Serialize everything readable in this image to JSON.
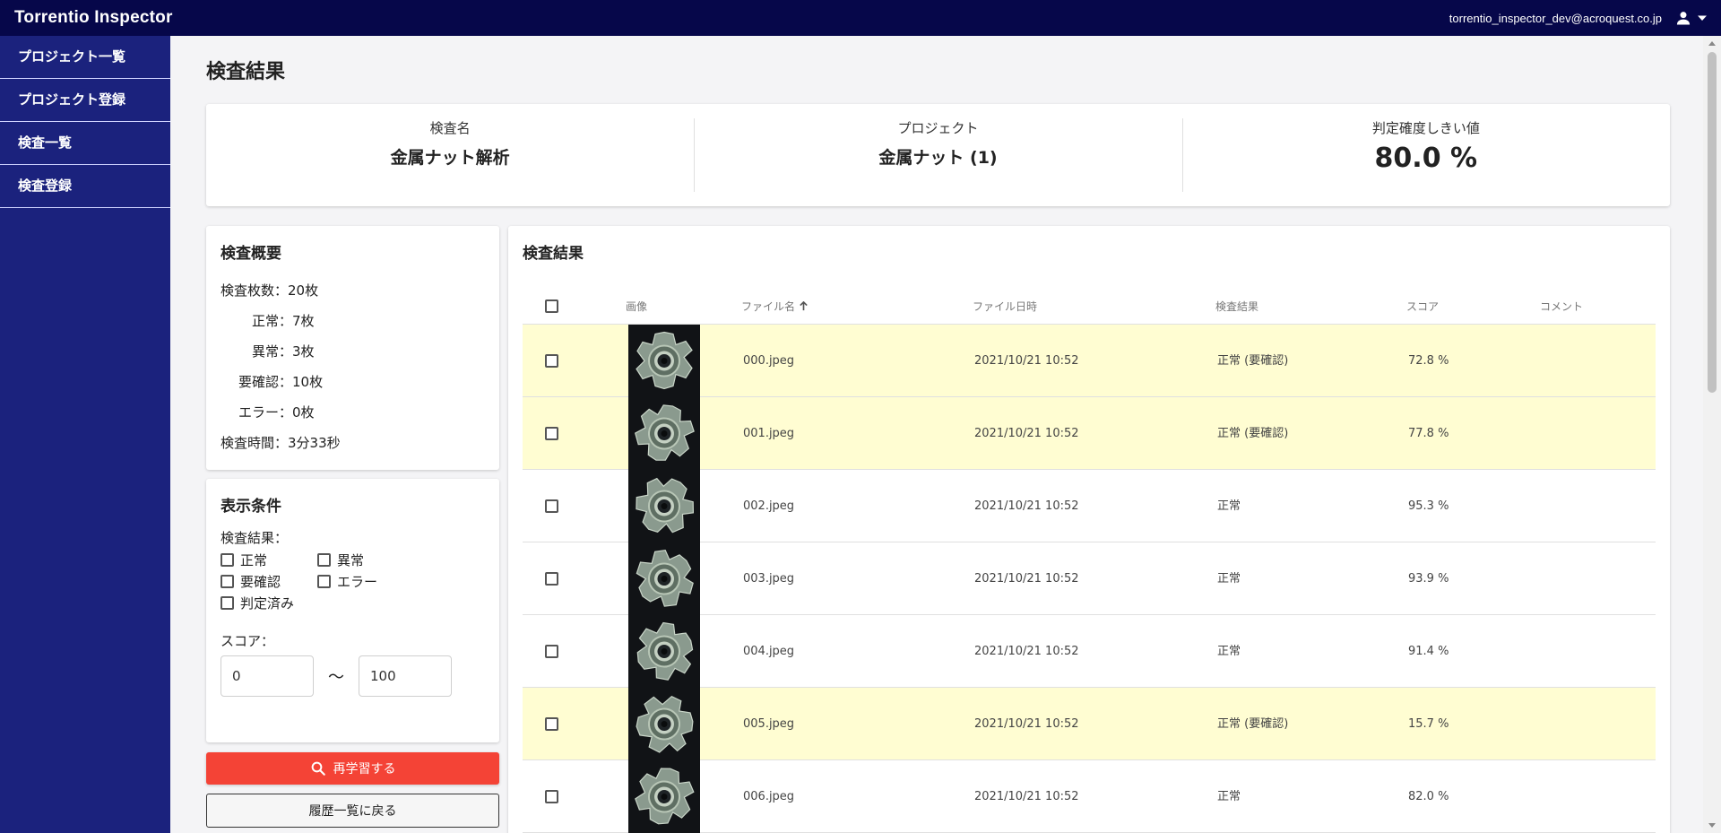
{
  "app": {
    "title": "Torrentio Inspector",
    "user_email": "torrentio_inspector_dev@acroquest.co.jp"
  },
  "sidebar": {
    "items": [
      {
        "label": "プロジェクト一覧"
      },
      {
        "label": "プロジェクト登録"
      },
      {
        "label": "検査一覧"
      },
      {
        "label": "検査登録"
      }
    ]
  },
  "page": {
    "title": "検査結果"
  },
  "info": {
    "inspection_name_label": "検査名",
    "inspection_name": "金属ナット解析",
    "project_label": "プロジェクト",
    "project": "金属ナット (1)",
    "threshold_label": "判定確度しきい値",
    "threshold": "80.0 %"
  },
  "summary": {
    "title": "検査概要",
    "lines": [
      {
        "label": "検査枚数：",
        "value": "20枚"
      },
      {
        "label": "正常：",
        "value": "7枚"
      },
      {
        "label": "異常：",
        "value": "3枚"
      },
      {
        "label": "要確認：",
        "value": "10枚"
      },
      {
        "label": "エラー：",
        "value": "0枚"
      },
      {
        "label": "検査時間：",
        "value": "3分33秒"
      }
    ]
  },
  "filters": {
    "title": "表示条件",
    "result_label": "検査結果：",
    "options": [
      "正常",
      "異常",
      "要確認",
      "エラー",
      "判定済み"
    ],
    "score_label": "スコア：",
    "score_min": "0",
    "score_max": "100",
    "tilde": "～"
  },
  "actions": {
    "retrain_label": "再学習する",
    "back_label": "履歴一覧に戻る"
  },
  "results": {
    "title": "検査結果",
    "columns": {
      "image": "画像",
      "filename": "ファイル名",
      "date": "ファイル日時",
      "result": "検査結果",
      "score": "スコア",
      "comment": "コメント"
    },
    "rows": [
      {
        "filename": "000.jpeg",
        "date": "2021/10/21 10:52",
        "result": "正常 (要確認)",
        "score": "72.8 %",
        "comment": "",
        "status": "warn"
      },
      {
        "filename": "001.jpeg",
        "date": "2021/10/21 10:52",
        "result": "正常 (要確認)",
        "score": "77.8 %",
        "comment": "",
        "status": "warn"
      },
      {
        "filename": "002.jpeg",
        "date": "2021/10/21 10:52",
        "result": "正常",
        "score": "95.3 %",
        "comment": "",
        "status": "ok"
      },
      {
        "filename": "003.jpeg",
        "date": "2021/10/21 10:52",
        "result": "正常",
        "score": "93.9 %",
        "comment": "",
        "status": "ok"
      },
      {
        "filename": "004.jpeg",
        "date": "2021/10/21 10:52",
        "result": "正常",
        "score": "91.4 %",
        "comment": "",
        "status": "ok"
      },
      {
        "filename": "005.jpeg",
        "date": "2021/10/21 10:52",
        "result": "正常 (要確認)",
        "score": "15.7 %",
        "comment": "",
        "status": "warn"
      },
      {
        "filename": "006.jpeg",
        "date": "2021/10/21 10:52",
        "result": "正常",
        "score": "82.0 %",
        "comment": "",
        "status": "ok"
      }
    ]
  },
  "colors": {
    "topbar": "#06074a",
    "sidebar": "#1b227d",
    "warn_row": "#fffdd2",
    "primary_button": "#f44336"
  },
  "icons": {
    "user": "person-icon",
    "dropdown": "caret-down-icon",
    "search": "search-icon",
    "sort": "arrow-up-icon",
    "thumbnail": "metal-nut-image"
  }
}
